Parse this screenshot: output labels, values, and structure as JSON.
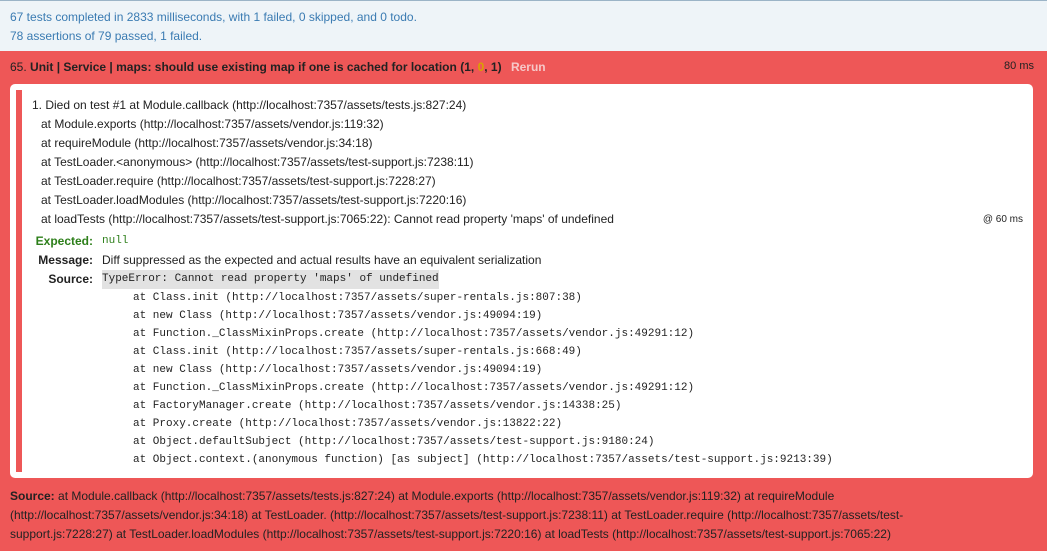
{
  "summary": {
    "line1": "67 tests completed in 2833 milliseconds, with 1 failed, 0 skipped, and 0 todo.",
    "line2": "78 assertions of 79 passed, 1 failed."
  },
  "test": {
    "number": "65.",
    "module_name": "Unit | Service | maps: should use existing map if one is cached for location",
    "counts_open": "(",
    "failed_count": "1",
    "passed_count": "0",
    "total_count": "1",
    "counts_close": ")",
    "rerun_label": "Rerun",
    "runtime": "80 ms"
  },
  "assertion": {
    "lines": [
      "1. Died on test #1     at Module.callback (http://localhost:7357/assets/tests.js:827:24)",
      "at Module.exports (http://localhost:7357/assets/vendor.js:119:32)",
      "at requireModule (http://localhost:7357/assets/vendor.js:34:18)",
      "at TestLoader.<anonymous> (http://localhost:7357/assets/test-support.js:7238:11)",
      "at TestLoader.require (http://localhost:7357/assets/test-support.js:7228:27)",
      "at TestLoader.loadModules (http://localhost:7357/assets/test-support.js:7220:16)",
      "at loadTests (http://localhost:7357/assets/test-support.js:7065:22): Cannot read property 'maps' of undefined"
    ],
    "duration": "@ 60 ms",
    "expected_label": "Expected:",
    "expected_value": "null",
    "message_label": "Message:",
    "message_value": "Diff suppressed as the expected and actual results have an equivalent serialization",
    "source_label": "Source:",
    "source_first": "TypeError: Cannot read property 'maps' of undefined",
    "stack": [
      "at Class.init (http://localhost:7357/assets/super-rentals.js:807:38)",
      "at new Class (http://localhost:7357/assets/vendor.js:49094:19)",
      "at Function._ClassMixinProps.create (http://localhost:7357/assets/vendor.js:49291:12)",
      "at Class.init (http://localhost:7357/assets/super-rentals.js:668:49)",
      "at new Class (http://localhost:7357/assets/vendor.js:49094:19)",
      "at Function._ClassMixinProps.create (http://localhost:7357/assets/vendor.js:49291:12)",
      "at FactoryManager.create (http://localhost:7357/assets/vendor.js:14338:25)",
      "at Proxy.create (http://localhost:7357/assets/vendor.js:13822:22)",
      "at Object.defaultSubject (http://localhost:7357/assets/test-support.js:9180:24)",
      "at Object.context.(anonymous function) [as subject] (http://localhost:7357/assets/test-support.js:9213:39)"
    ]
  },
  "footer": {
    "source_label": "Source:",
    "lines": [
      "at Module.callback (http://localhost:7357/assets/tests.js:827:24) at Module.exports (http://localhost:7357/assets/vendor.js:119:32) at requireModule",
      "(http://localhost:7357/assets/vendor.js:34:18) at TestLoader. (http://localhost:7357/assets/test-support.js:7238:11) at TestLoader.require (http://localhost:7357/assets/test-",
      "support.js:7228:27) at TestLoader.loadModules (http://localhost:7357/assets/test-support.js:7220:16) at loadTests (http://localhost:7357/assets/test-support.js:7065:22)"
    ]
  },
  "colors": {
    "fail_bg": "#ee5757",
    "summary_bg": "#eef4f8",
    "summary_text": "#3a7bb2",
    "expected_green": "#2d7f1a",
    "passed_count": "#d9a300"
  }
}
